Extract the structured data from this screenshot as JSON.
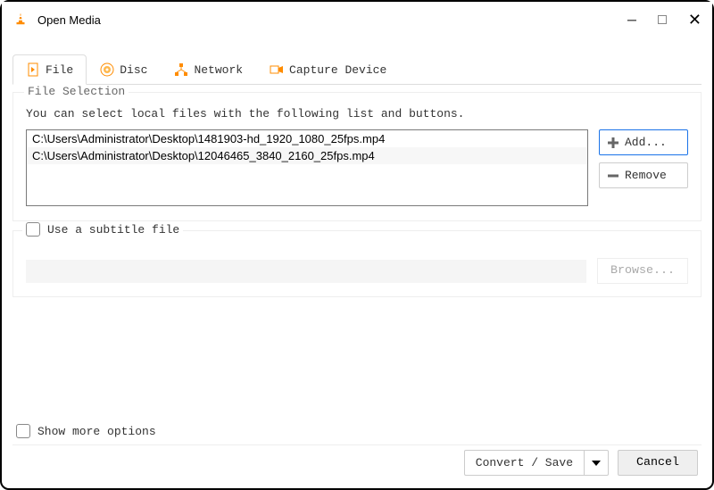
{
  "window": {
    "title": "Open Media"
  },
  "tabs": [
    {
      "label": "File",
      "icon": "file-icon"
    },
    {
      "label": "Disc",
      "icon": "disc-icon"
    },
    {
      "label": "Network",
      "icon": "network-icon"
    },
    {
      "label": "Capture Device",
      "icon": "capture-icon"
    }
  ],
  "active_tab": 0,
  "file_selection": {
    "legend": "File Selection",
    "description": "You can select local files with the following list and buttons.",
    "files": [
      "C:\\Users\\Administrator\\Desktop\\1481903-hd_1920_1080_25fps.mp4",
      "C:\\Users\\Administrator\\Desktop\\12046465_3840_2160_25fps.mp4"
    ],
    "add_label": "Add...",
    "remove_label": "Remove"
  },
  "subtitle": {
    "checkbox_label": "Use a subtitle file",
    "checked": false,
    "browse_label": "Browse..."
  },
  "show_more": {
    "label": "Show more options",
    "checked": false
  },
  "footer": {
    "convert_label": "Convert / Save",
    "cancel_label": "Cancel"
  }
}
